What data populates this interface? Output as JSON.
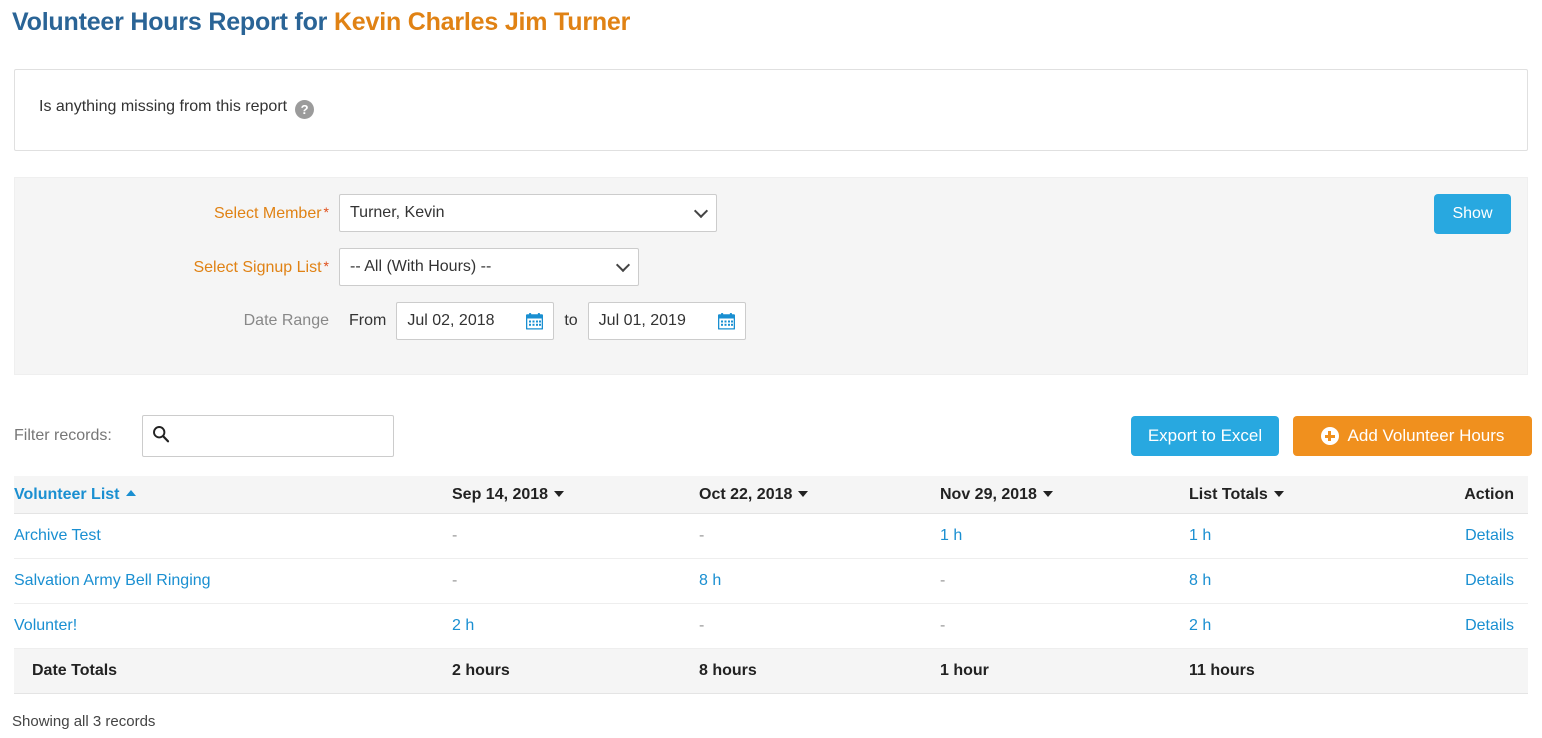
{
  "header": {
    "title_prefix": "Volunteer Hours Report for ",
    "member_name": "Kevin Charles Jim Turner"
  },
  "info_box": {
    "text": "Is anything missing from this report",
    "help_icon": "question-mark-circle-icon",
    "help_glyph": "?"
  },
  "filters": {
    "member_label": "Select Member",
    "member_required": "*",
    "member_value": "Turner, Kevin",
    "signup_label": "Select Signup List",
    "signup_required": "*",
    "signup_value": "-- All (With Hours) --",
    "date_range_label": "Date Range",
    "from_label": "From",
    "from_value": "Jul 02, 2018",
    "to_label": "to",
    "to_value": "Jul 01, 2019",
    "show_button": "Show",
    "calendar_icon": "calendar-icon"
  },
  "toolbar": {
    "filter_label": "Filter records:",
    "search_value": "",
    "search_placeholder": "",
    "search_icon": "search-icon",
    "export_button": "Export to Excel",
    "add_button": "Add Volunteer Hours",
    "add_icon": "plus-circle-icon"
  },
  "table": {
    "columns": [
      {
        "label": "Volunteer List",
        "sort": "asc"
      },
      {
        "label": "Sep 14, 2018",
        "sort": "desc"
      },
      {
        "label": "Oct 22, 2018",
        "sort": "desc"
      },
      {
        "label": "Nov 29, 2018",
        "sort": "desc"
      },
      {
        "label": "List Totals",
        "sort": "desc"
      },
      {
        "label": "Action",
        "sort": "none"
      }
    ],
    "rows": [
      {
        "name": "Archive Test",
        "d1": "-",
        "d2": "-",
        "d3": "1 h",
        "total": "1 h",
        "action": "Details"
      },
      {
        "name": "Salvation Army Bell Ringing",
        "d1": "-",
        "d2": "8 h",
        "d3": "-",
        "total": "8 h",
        "action": "Details"
      },
      {
        "name": "Volunter!",
        "d1": "2 h",
        "d2": "-",
        "d3": "-",
        "total": "2 h",
        "action": "Details"
      }
    ],
    "totals": {
      "name": "Date Totals",
      "d1": "2 hours",
      "d2": "8 hours",
      "d3": "1 hour",
      "total": "11 hours",
      "action": ""
    },
    "footer": "Showing all 3 records"
  },
  "colors": {
    "title_blue": "#2a6496",
    "title_orange": "#e08214",
    "link_blue": "#1a8fd1",
    "button_blue": "#28a8e0",
    "button_orange": "#f0901e",
    "label_orange": "#e08214",
    "panel_gray": "#f5f5f5"
  }
}
